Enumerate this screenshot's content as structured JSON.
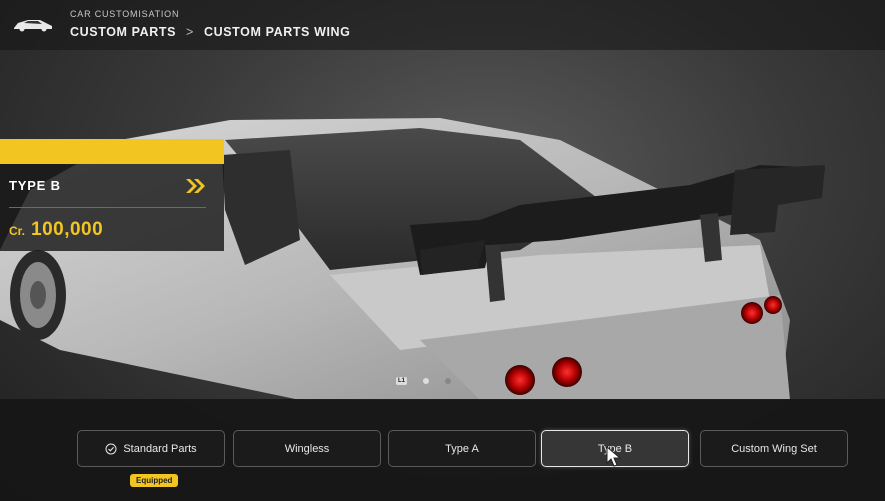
{
  "header": {
    "subtitle": "CAR CUSTOMISATION",
    "breadcrumb": [
      "CUSTOM PARTS",
      "CUSTOM PARTS WING"
    ],
    "separator": ">"
  },
  "info_panel": {
    "part_name": "TYPE B",
    "price_prefix": "Cr.",
    "price_value": "100,000",
    "accent_color": "#f2c520"
  },
  "carousel": {
    "left_button": "L1",
    "right_button": "R1",
    "pages": 2,
    "active_page": 1
  },
  "options": [
    {
      "label": "Standard Parts",
      "icon": "check-circle-icon",
      "equipped": true
    },
    {
      "label": "Wingless"
    },
    {
      "label": "Type A"
    },
    {
      "label": "Type B",
      "selected": true
    },
    {
      "label": "Custom Wing Set"
    }
  ],
  "equipped_badge": "Equipped"
}
